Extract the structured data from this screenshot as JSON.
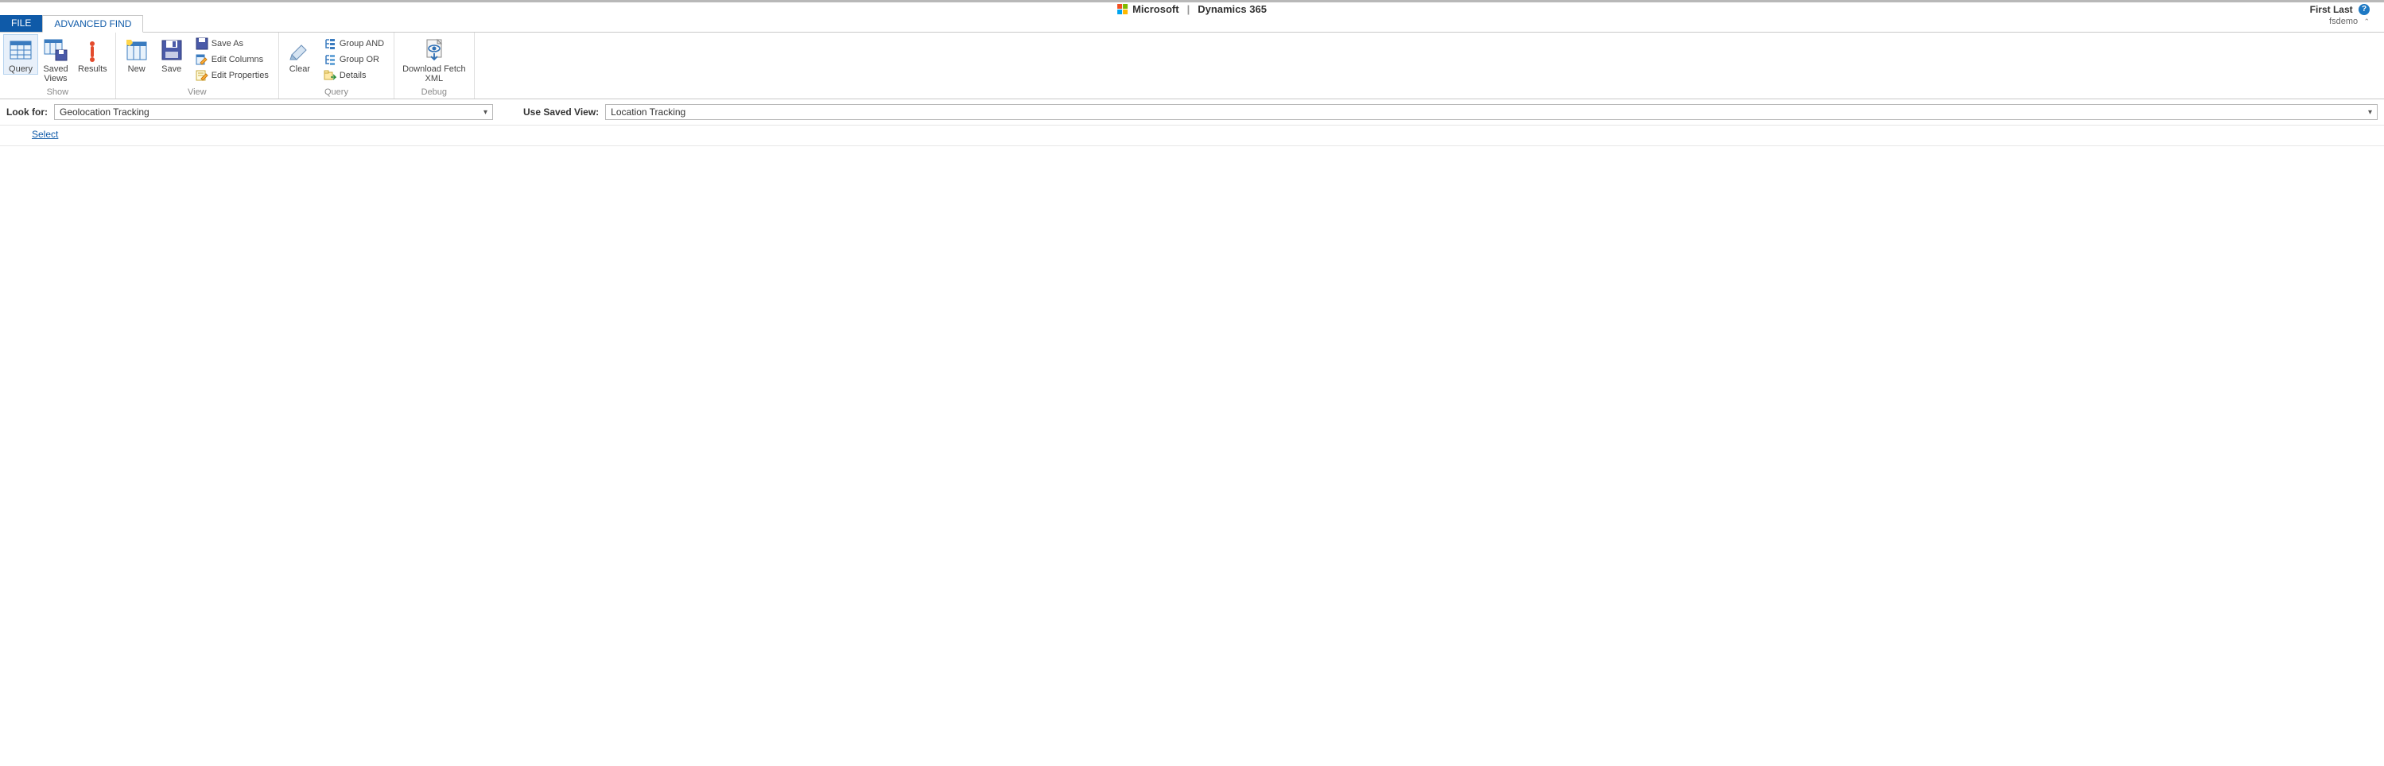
{
  "brand": {
    "microsoft": "Microsoft",
    "product": "Dynamics 365"
  },
  "user": {
    "name": "First Last",
    "org": "fsdemo"
  },
  "tabs": {
    "file": "FILE",
    "advanced_find": "ADVANCED FIND"
  },
  "ribbon": {
    "show": {
      "label": "Show",
      "query": "Query",
      "saved_views": "Saved\nViews",
      "results": "Results"
    },
    "view": {
      "label": "View",
      "new": "New",
      "save": "Save",
      "save_as": "Save As",
      "edit_columns": "Edit Columns",
      "edit_properties": "Edit Properties"
    },
    "query": {
      "label": "Query",
      "clear": "Clear",
      "group_and": "Group AND",
      "group_or": "Group OR",
      "details": "Details"
    },
    "debug": {
      "label": "Debug",
      "download_fetch_xml": "Download Fetch\nXML"
    }
  },
  "filters": {
    "look_for_label": "Look for:",
    "look_for_value": "Geolocation Tracking",
    "use_saved_view_label": "Use Saved View:",
    "use_saved_view_value": "Location Tracking"
  },
  "criteria": {
    "select": "Select"
  }
}
